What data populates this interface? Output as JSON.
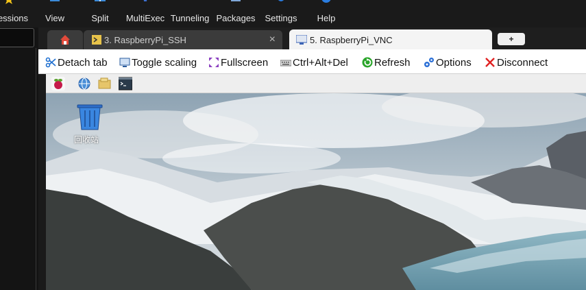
{
  "menubar": {
    "items": [
      {
        "label": "essions",
        "icon": "star-icon"
      },
      {
        "label": "View",
        "icon": "view-icon"
      },
      {
        "label": "Split",
        "icon": "split-icon"
      },
      {
        "label": "MultiExec",
        "icon": "multiexec-icon"
      },
      {
        "label": "Tunneling",
        "icon": "tunneling-icon"
      },
      {
        "label": "Packages",
        "icon": "packages-icon"
      },
      {
        "label": "Settings",
        "icon": "gear-icon"
      },
      {
        "label": "Help",
        "icon": "help-icon"
      }
    ]
  },
  "tabs": [
    {
      "label": "",
      "icon": "home-icon"
    },
    {
      "label": "3. RaspberryPi_SSH",
      "icon": "ssh-icon",
      "close": "×"
    },
    {
      "label": "5. RaspberryPi_VNC",
      "icon": "vnc-icon",
      "close": "×"
    }
  ],
  "newtab_label": "+",
  "toolbar": {
    "items": [
      {
        "label": "Detach tab",
        "icon": "scissors-icon"
      },
      {
        "label": "Toggle scaling",
        "icon": "monitor-icon"
      },
      {
        "label": "Fullscreen",
        "icon": "fullscreen-icon"
      },
      {
        "label": "Ctrl+Alt+Del",
        "icon": "keyboard-icon"
      },
      {
        "label": "Refresh",
        "icon": "refresh-icon"
      },
      {
        "label": "Options",
        "icon": "gears-icon"
      },
      {
        "label": "Disconnect",
        "icon": "close-red-icon"
      }
    ]
  },
  "desktop": {
    "trash_label": "回收站"
  },
  "colors": {
    "accent_blue": "#1e6fd0",
    "refresh_green": "#2aa52a",
    "disconnect_red": "#e02020",
    "raspberry_red": "#c51a4a"
  }
}
